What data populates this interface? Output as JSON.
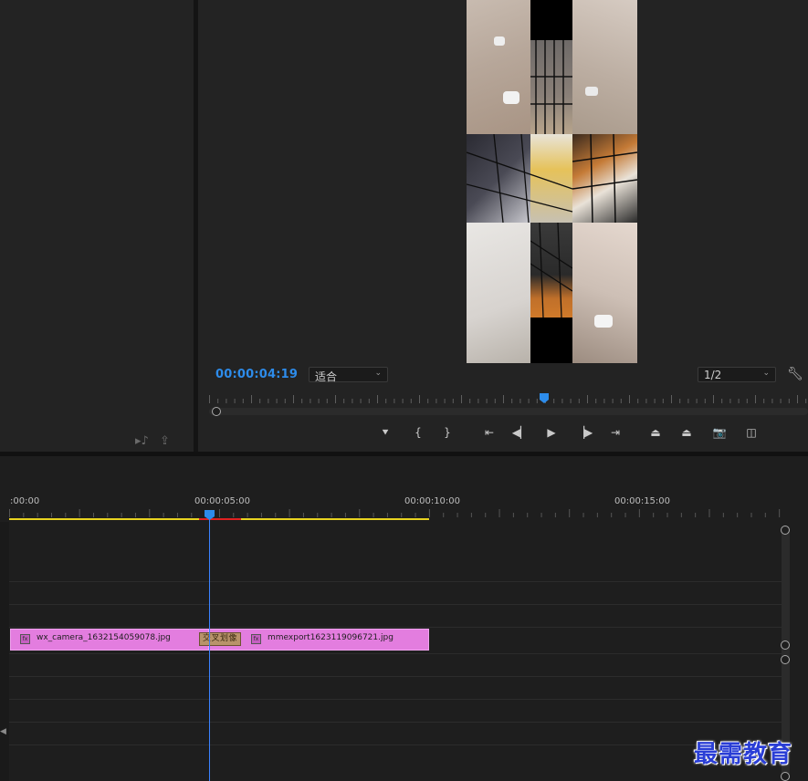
{
  "program_monitor": {
    "timecode": "00:00:04:19",
    "fit_select": {
      "value": "适合"
    },
    "resolution_select": {
      "value": "1/2"
    }
  },
  "transport": {
    "buttons": [
      {
        "icon": "add-marker-icon",
        "glyph": "⯆"
      },
      {
        "icon": "mark-in-icon",
        "glyph": "{"
      },
      {
        "icon": "mark-out-icon",
        "glyph": "}"
      },
      {
        "icon": "go-to-in-icon",
        "glyph": "⇤"
      },
      {
        "icon": "step-back-icon",
        "glyph": "◀▏"
      },
      {
        "icon": "play-icon",
        "glyph": "▶"
      },
      {
        "icon": "step-forward-icon",
        "glyph": "▕▶"
      },
      {
        "icon": "go-to-out-icon",
        "glyph": "⇥"
      },
      {
        "icon": "lift-icon",
        "glyph": "⏏"
      },
      {
        "icon": "extract-icon",
        "glyph": "⏏"
      },
      {
        "icon": "export-frame-icon",
        "glyph": "📷"
      },
      {
        "icon": "comparison-view-icon",
        "glyph": "◫"
      }
    ]
  },
  "timeline": {
    "ruler_labels": [
      ":00:00",
      "00:00:05:00",
      "00:00:10:00",
      "00:00:15:00"
    ],
    "clips": [
      {
        "name": "wx_camera_1632154059078.jpg"
      },
      {
        "name": "mmexport1623119096721.jpg"
      }
    ],
    "transition": {
      "label": "交叉划像"
    }
  },
  "watermark": "最需教育",
  "colors": {
    "timecode": "#2d8ceb",
    "clip": "#e37ddf",
    "playhead": "#3a82ff",
    "work_area": "#e8d320",
    "render_bar_red": "#e02020"
  }
}
